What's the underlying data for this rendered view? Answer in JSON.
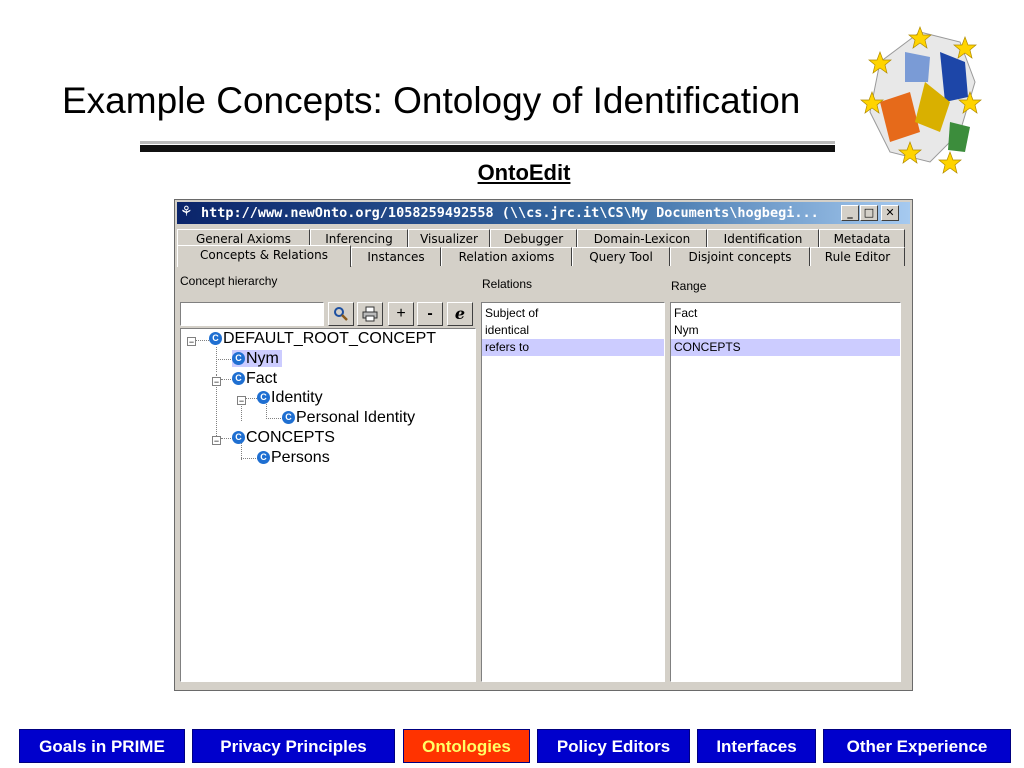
{
  "slide": {
    "title": "Example Concepts: Ontology of Identification",
    "subtitle": "OntoEdit"
  },
  "window": {
    "title": "http://www.newOnto.org/1058259492558 (\\\\cs.jrc.it\\CS\\My Documents\\hogbegi...",
    "controls": {
      "minimize": "_",
      "maximize": "□",
      "close": "✕"
    },
    "tabs_row1": [
      "General Axioms",
      "Inferencing",
      "Visualizer",
      "Debugger",
      "Domain-Lexicon",
      "Identification",
      "Metadata"
    ],
    "tabs_row2": [
      "Concepts & Relations",
      "Instances",
      "Relation axioms",
      "Query Tool",
      "Disjoint concepts",
      "Rule Editor"
    ],
    "active_tab": "Concepts & Relations"
  },
  "concept_panel": {
    "heading": "Concept hierarchy",
    "search_value": "",
    "toolbar": {
      "plus": "+",
      "minus": "-",
      "edit": "e"
    },
    "tree": [
      {
        "label": "DEFAULT_ROOT_CONCEPT",
        "icon": "C"
      },
      {
        "label": "Nym",
        "icon": "C",
        "selected": true
      },
      {
        "label": "Fact",
        "icon": "C"
      },
      {
        "label": "Identity",
        "icon": "C"
      },
      {
        "label": "Personal Identity",
        "icon": "C"
      },
      {
        "label": "CONCEPTS",
        "icon": "C"
      },
      {
        "label": "Persons",
        "icon": "C"
      }
    ]
  },
  "relations_panel": {
    "heading": "Relations",
    "rows": [
      "Subject of",
      "identical",
      "refers to"
    ],
    "selected_index": 2
  },
  "range_panel": {
    "heading": "Range",
    "rows": [
      "Fact",
      "Nym",
      "CONCEPTS"
    ],
    "selected_index": 2
  },
  "nav": {
    "items": [
      "Goals in PRIME",
      "Privacy Principles",
      "Ontologies",
      "Policy Editors",
      "Interfaces",
      "Other Experience"
    ],
    "active": "Ontologies"
  },
  "colors": {
    "nav_bg": "#0000cc",
    "nav_active_bg": "#ff3300",
    "nav_active_text": "#ffff66",
    "selection": "#ccccff"
  }
}
